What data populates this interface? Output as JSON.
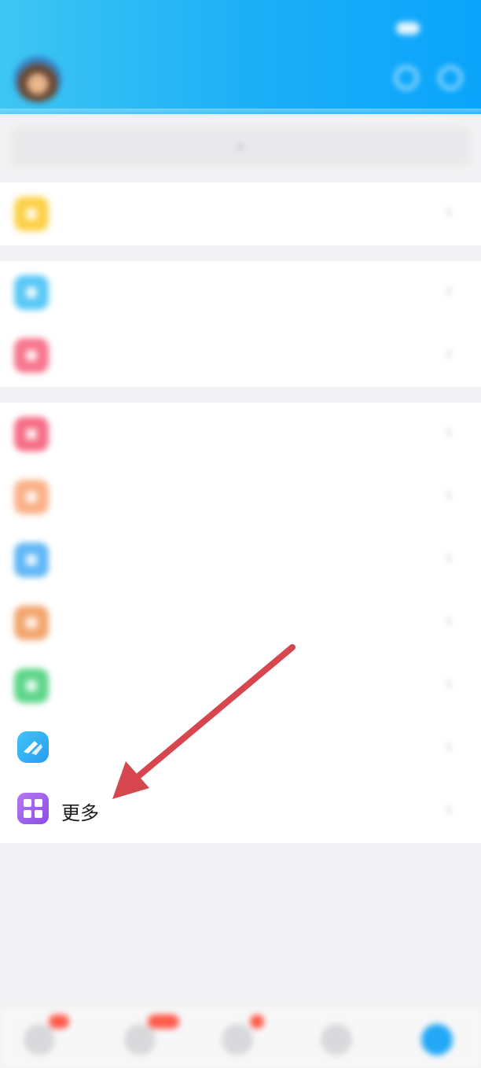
{
  "status_bar": {
    "time": "",
    "icons": ""
  },
  "header": {
    "title": ""
  },
  "search": {
    "placeholder": ""
  },
  "menu": {
    "more_label": "更多"
  },
  "colors": {
    "header_start": "#3ec6f3",
    "header_end": "#0aa4fb",
    "arrow": "#d6464e",
    "more_icon": "#a463ec"
  },
  "icons": {
    "group1": [
      "yellow-app-icon"
    ],
    "group2": [
      "blue-app-icon",
      "pink-app-icon"
    ],
    "group3": [
      "pink-heart-icon",
      "orange-app-icon",
      "blue-app-icon",
      "orange-app-icon",
      "green-app-icon",
      "blue-wing-icon",
      "grid-icon"
    ]
  }
}
